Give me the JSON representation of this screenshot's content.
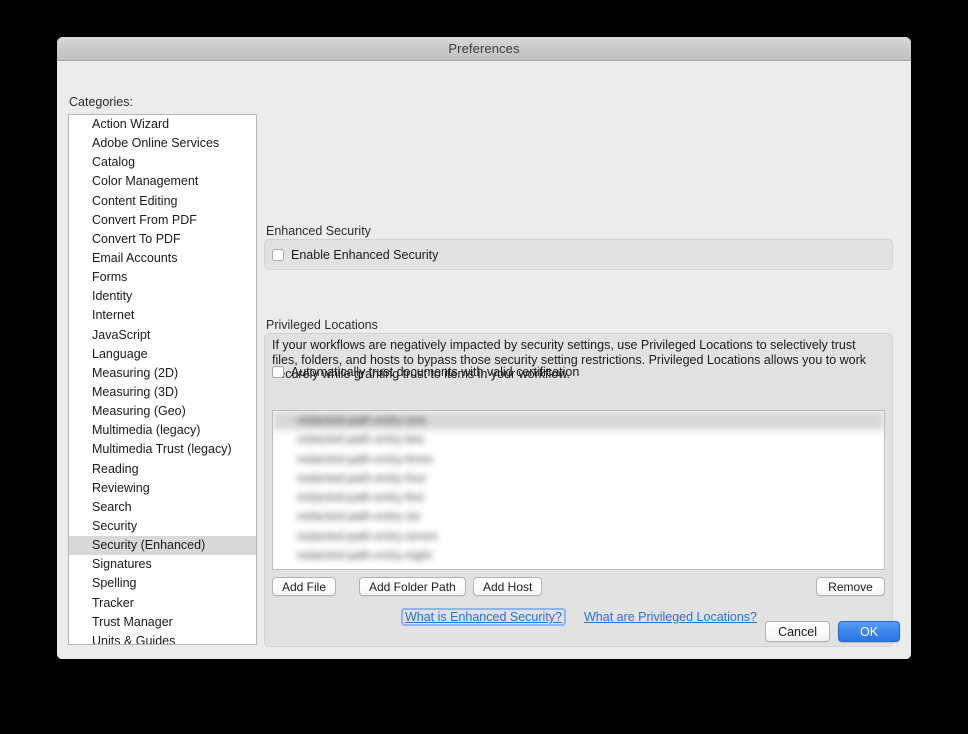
{
  "window": {
    "title": "Preferences"
  },
  "sidebar": {
    "label": "Categories:",
    "selected": "Security (Enhanced)",
    "items": [
      {
        "label": "Action Wizard"
      },
      {
        "label": "Adobe Online Services"
      },
      {
        "label": "Catalog"
      },
      {
        "label": "Color Management"
      },
      {
        "label": "Content Editing"
      },
      {
        "label": "Convert From PDF"
      },
      {
        "label": "Convert To PDF"
      },
      {
        "label": "Email Accounts"
      },
      {
        "label": "Forms"
      },
      {
        "label": "Identity"
      },
      {
        "label": "Internet"
      },
      {
        "label": "JavaScript"
      },
      {
        "label": "Language"
      },
      {
        "label": "Measuring (2D)"
      },
      {
        "label": "Measuring (3D)"
      },
      {
        "label": "Measuring (Geo)"
      },
      {
        "label": "Multimedia (legacy)"
      },
      {
        "label": "Multimedia Trust (legacy)"
      },
      {
        "label": "Reading"
      },
      {
        "label": "Reviewing"
      },
      {
        "label": "Search"
      },
      {
        "label": "Security"
      },
      {
        "label": "Security (Enhanced)"
      },
      {
        "label": "Signatures"
      },
      {
        "label": "Spelling"
      },
      {
        "label": "Tracker"
      },
      {
        "label": "Trust Manager"
      },
      {
        "label": "Units & Guides"
      }
    ]
  },
  "enhanced_security": {
    "group_label": "Enhanced Security",
    "checkbox_label": "Enable Enhanced Security",
    "checked": false
  },
  "privileged_locations": {
    "group_label": "Privileged Locations",
    "description": "If your workflows are negatively impacted by security settings, use Privileged Locations to selectively trust files, folders, and hosts to bypass those security setting restrictions. Privileged Locations allows you to work securely while granting trust to items in your workflow.",
    "auto_trust_label": "Automatically trust documents with valid certification",
    "auto_trust_checked": false,
    "locations": [
      {
        "text": "redacted-path-entry-one",
        "selected": true
      },
      {
        "text": "redacted-path-entry-two",
        "selected": false
      },
      {
        "text": "redacted-path-entry-three",
        "selected": false
      },
      {
        "text": "redacted-path-entry-four",
        "selected": false
      },
      {
        "text": "redacted-path-entry-five",
        "selected": false
      },
      {
        "text": "redacted-path-entry-six",
        "selected": false
      },
      {
        "text": "redacted-path-entry-seven",
        "selected": false
      },
      {
        "text": "redacted-path-entry-eight",
        "selected": false
      }
    ],
    "buttons": {
      "add_file": "Add File",
      "add_folder_path": "Add Folder Path",
      "add_host": "Add Host",
      "remove": "Remove"
    }
  },
  "help_links": {
    "enhanced_security": "What is Enhanced Security?",
    "privileged_locations": "What are Privileged Locations?",
    "focused": "What is Enhanced Security?"
  },
  "footer": {
    "cancel": "Cancel",
    "ok": "OK"
  },
  "colors": {
    "accent": "#3e86ec",
    "link": "#2572d6",
    "window_bg": "#ececec",
    "group_bg": "#e2e2e2",
    "selection": "#d9d9d9"
  }
}
